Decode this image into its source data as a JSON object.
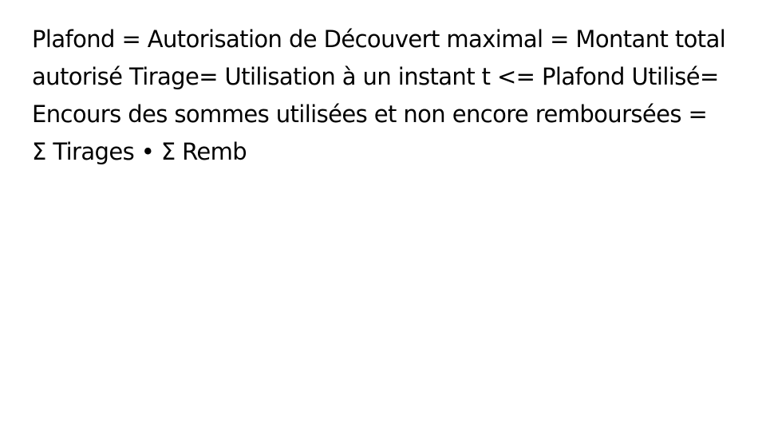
{
  "slide": {
    "text": "Plafond = Autorisation de Découvert maximal = Montant total autorisé Tirage= Utilisation à un instant t <= Plafond Utilisé= Encours des sommes utilisées et non encore remboursées = Σ Tirages • Σ Remb"
  },
  "colors": {
    "background": "#ffffff",
    "text": "#000000"
  }
}
